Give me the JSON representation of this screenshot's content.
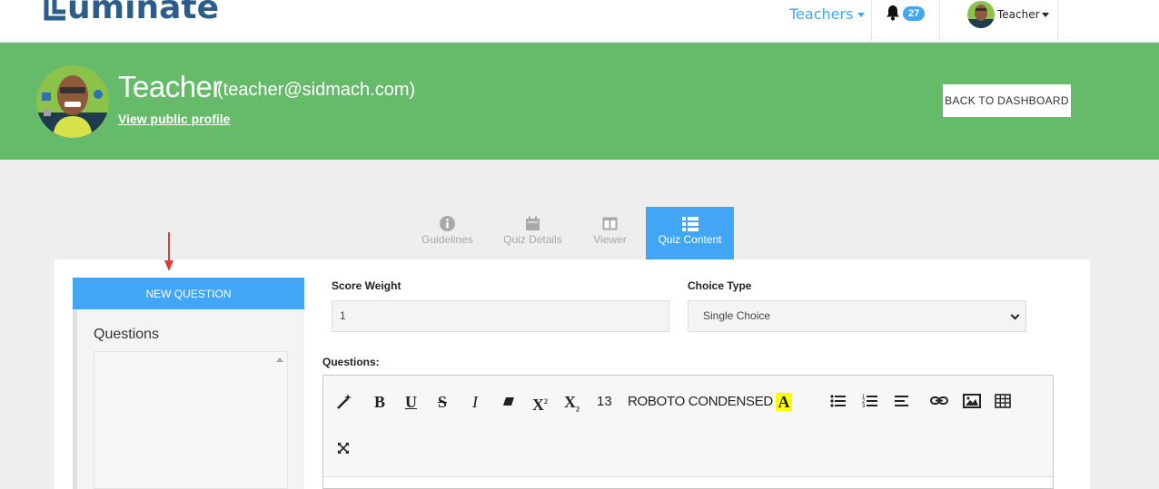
{
  "nav": {
    "logo_text": "uminate",
    "teachers_label": "Teachers",
    "notification_count": "27",
    "user_label": "Teacher"
  },
  "banner": {
    "name": "Teacher",
    "email": "(teacher@sidmach.com)",
    "public_profile_link": "View public profile",
    "back_button": "BACK TO DASHBOARD"
  },
  "tabs": [
    {
      "label": "Guidelines",
      "icon": "info-circle-icon"
    },
    {
      "label": "Quiz Details",
      "icon": "calendar-icon"
    },
    {
      "label": "Viewer",
      "icon": "columns-icon"
    },
    {
      "label": "Quiz Content",
      "icon": "list-icon",
      "active": true
    }
  ],
  "sidebar": {
    "new_question_button": "NEW QUESTION",
    "questions_title": "Questions"
  },
  "form": {
    "score_weight_label": "Score Weight",
    "score_weight_value": "1",
    "choice_type_label": "Choice Type",
    "choice_type_value": "Single Choice",
    "questions_label": "Questions:"
  },
  "editor": {
    "font_size": "13",
    "font_name": "ROBOTO CONDENSED",
    "tools": [
      "magic-icon",
      "bold-icon",
      "underline-icon",
      "strikethrough-icon",
      "italic-icon",
      "eraser-icon",
      "superscript-icon",
      "subscript-icon",
      "font-size",
      "font-name",
      "highlight-icon",
      "unordered-list-icon",
      "ordered-list-icon",
      "align-icon",
      "link-icon",
      "image-icon",
      "table-icon",
      "fullscreen-icon"
    ]
  },
  "colors": {
    "accent": "#42a5f5",
    "banner_green": "#66bb6a",
    "annotation_arrow": "#e53935"
  }
}
